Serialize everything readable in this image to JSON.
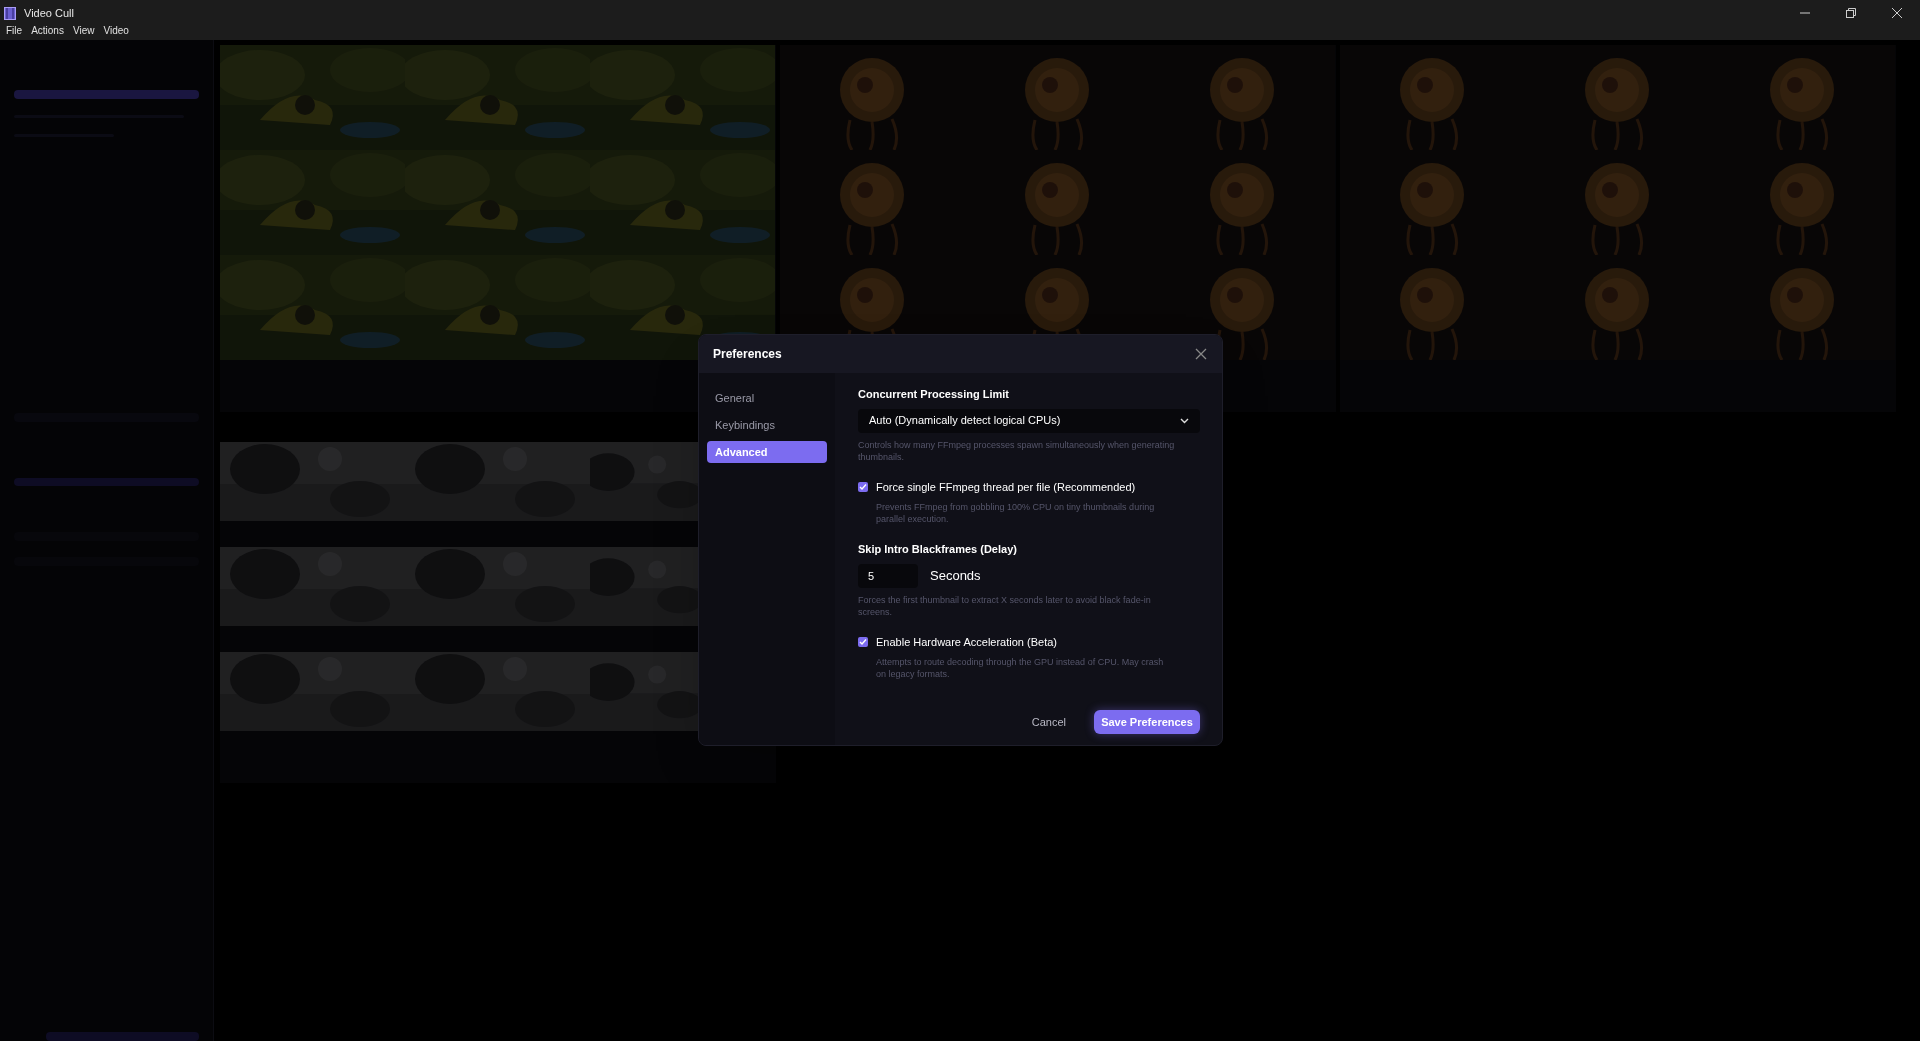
{
  "window": {
    "title": "Video Cull"
  },
  "menu": [
    "File",
    "Actions",
    "View",
    "Video"
  ],
  "dialog": {
    "title": "Preferences",
    "tabs": [
      {
        "label": "General",
        "selected": false
      },
      {
        "label": "Keybindings",
        "selected": false
      },
      {
        "label": "Advanced",
        "selected": true
      }
    ],
    "settings": [
      {
        "kind": "select",
        "label": "Concurrent Processing Limit",
        "value": "Auto (Dynamically detect logical CPUs)",
        "help": "Controls how many FFmpeg processes spawn simultaneously when generating thumbnails."
      },
      {
        "kind": "checkbox",
        "label": "Force single FFmpeg thread per file (Recommended)",
        "checked": true,
        "help": "Prevents FFmpeg from gobbling 100% CPU on tiny thumbnails during parallel execution."
      },
      {
        "kind": "number",
        "label": "Skip Intro Blackframes (Delay)",
        "value": "5",
        "unit": "Seconds",
        "help": "Forces the first thumbnail to extract X seconds later to avoid black fade-in screens."
      },
      {
        "kind": "checkbox",
        "label": "Enable Hardware Acceleration (Beta)",
        "checked": true,
        "help": "Attempts to route decoding through the GPU instead of CPU. May crash on legacy formats."
      }
    ],
    "buttons": {
      "cancel": "Cancel",
      "save": "Save Preferences"
    }
  }
}
